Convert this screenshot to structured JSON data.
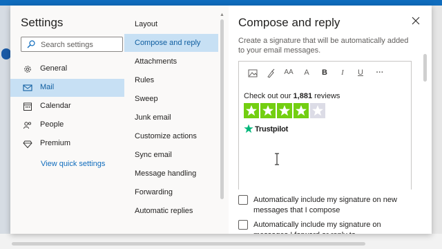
{
  "settings": {
    "title": "Settings",
    "search_placeholder": "Search settings",
    "categories": [
      {
        "label": "General",
        "icon": "gear-icon",
        "selected": false
      },
      {
        "label": "Mail",
        "icon": "mail-icon",
        "selected": true
      },
      {
        "label": "Calendar",
        "icon": "calendar-icon",
        "selected": false
      },
      {
        "label": "People",
        "icon": "people-icon",
        "selected": false
      },
      {
        "label": "Premium",
        "icon": "diamond-icon",
        "selected": false
      }
    ],
    "quick_link": "View quick settings"
  },
  "mail_nav": {
    "items": [
      {
        "label": "Layout",
        "selected": false
      },
      {
        "label": "Compose and reply",
        "selected": true
      },
      {
        "label": "Attachments",
        "selected": false
      },
      {
        "label": "Rules",
        "selected": false
      },
      {
        "label": "Sweep",
        "selected": false
      },
      {
        "label": "Junk email",
        "selected": false
      },
      {
        "label": "Customize actions",
        "selected": false
      },
      {
        "label": "Sync email",
        "selected": false
      },
      {
        "label": "Message handling",
        "selected": false
      },
      {
        "label": "Forwarding",
        "selected": false
      },
      {
        "label": "Automatic replies",
        "selected": false
      }
    ]
  },
  "pane": {
    "heading": "Compose and reply",
    "description": "Create a signature that will be automatically added to your email messages.",
    "toolbar": [
      "image-icon",
      "format-painter-icon",
      "font-size-icon",
      "font-grow-icon",
      "bold-icon",
      "italic-icon",
      "underline-icon",
      "more-icon"
    ],
    "toolbar_text": {
      "font_size": "AA",
      "grow": "A",
      "bold": "B",
      "italic": "I",
      "underline": "U",
      "more": "···"
    },
    "signature": {
      "text_before": "Check out our ",
      "reviews_count": "1,881",
      "text_after": " reviews",
      "rating_stars_filled": 4,
      "rating_stars_total": 5,
      "brand": "Trustpilot",
      "star_color": "#73cf11",
      "brand_star_color": "#00b67a"
    },
    "checkboxes": [
      {
        "label": "Automatically include my signature on new messages that I compose",
        "checked": false
      },
      {
        "label": "Automatically include my signature on messages I forward or reply to",
        "checked": false
      }
    ]
  },
  "colors": {
    "accent": "#0f6cbd",
    "selection": "#c7e0f4"
  }
}
